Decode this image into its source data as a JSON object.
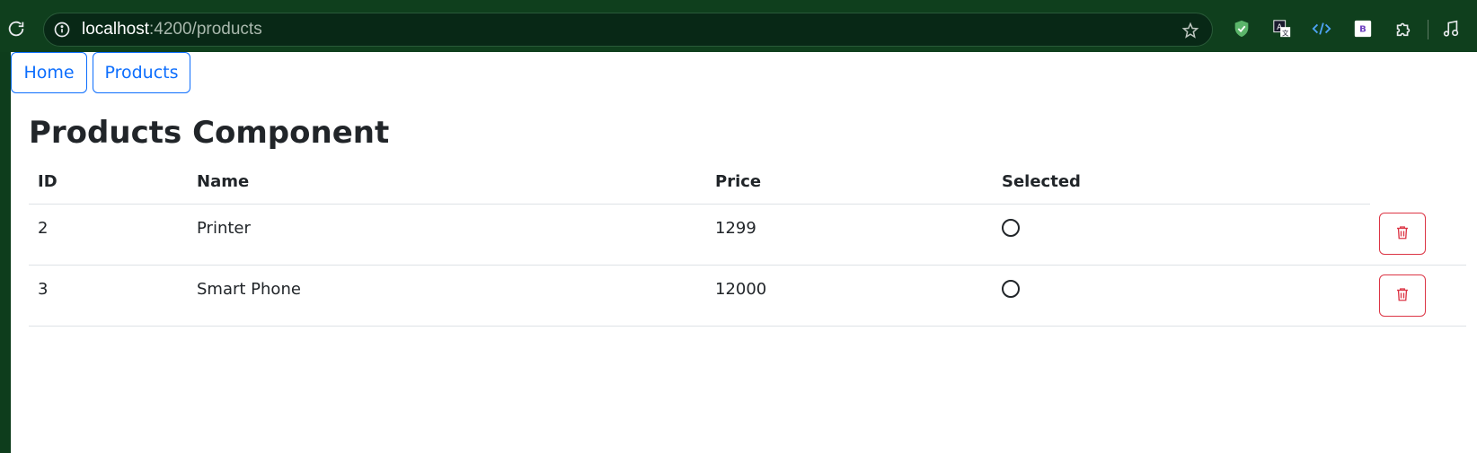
{
  "browser": {
    "url_host": "localhost",
    "url_rest": ":4200/products",
    "icons": [
      "reload-icon",
      "site-info-icon",
      "bookmark-star-icon",
      "shield-extension-icon",
      "translate-extension-icon",
      "code-extension-icon",
      "bootstrap-extension-icon",
      "puzzle-extensions-icon",
      "media-control-icon"
    ]
  },
  "nav": {
    "home_label": "Home",
    "products_label": "Products"
  },
  "page": {
    "title": "Products Component"
  },
  "table": {
    "headers": [
      "ID",
      "Name",
      "Price",
      "Selected"
    ],
    "rows": [
      {
        "id": "2",
        "name": "Printer",
        "price": "1299"
      },
      {
        "id": "3",
        "name": "Smart Phone",
        "price": "12000"
      }
    ]
  },
  "colors": {
    "primary": "#0d6efd",
    "danger": "#dc3545",
    "browser_bg": "#0f3f1d"
  }
}
